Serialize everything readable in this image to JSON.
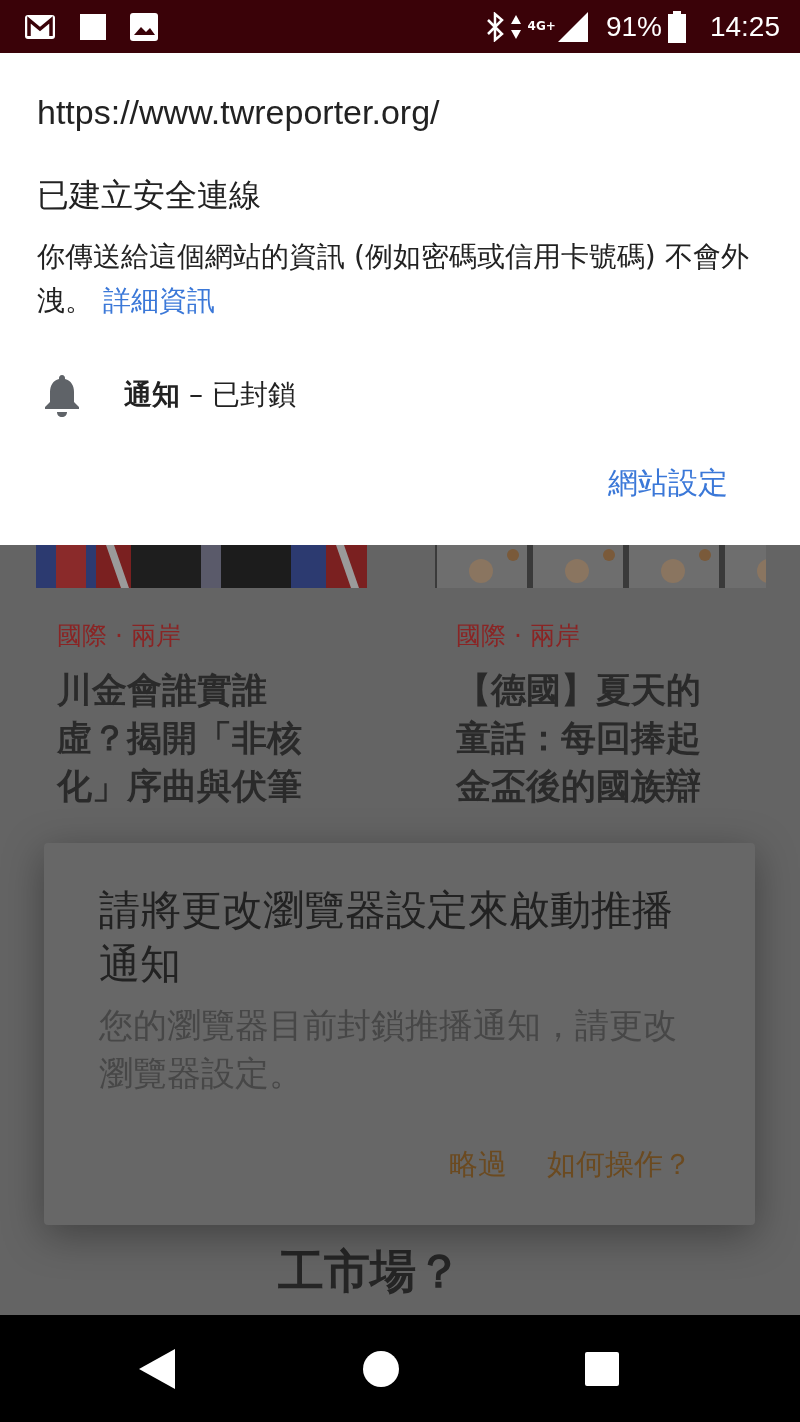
{
  "status_bar": {
    "network": "4G+",
    "battery": "91%",
    "time": "14:25"
  },
  "site_info": {
    "url": "https://www.twreporter.org/",
    "title": "已建立安全連線",
    "description": "你傳送給這個網站的資訊 (例如密碼或信用卡號碼) 不會外洩。",
    "details_link": "詳細資訊",
    "permission": "**通知** – 已封鎖",
    "settings_link": "網站設定"
  },
  "articles": [
    {
      "category": "國際 · 兩岸",
      "headline": "川金會誰實誰虛？揭開「非核化」序曲與伏筆"
    },
    {
      "category": "國際 · 兩岸",
      "headline": "【德國】夏天的童話：每回捧起金盃後的國族辯"
    }
  ],
  "bottom_headline": "工市場？",
  "dialog": {
    "title": "請將更改瀏覽器設定來啟動推播通知",
    "message": "您的瀏覽器目前封鎖推播通知，請更改瀏覽器設定。",
    "buttons": [
      "略過",
      "如何操作？"
    ]
  }
}
